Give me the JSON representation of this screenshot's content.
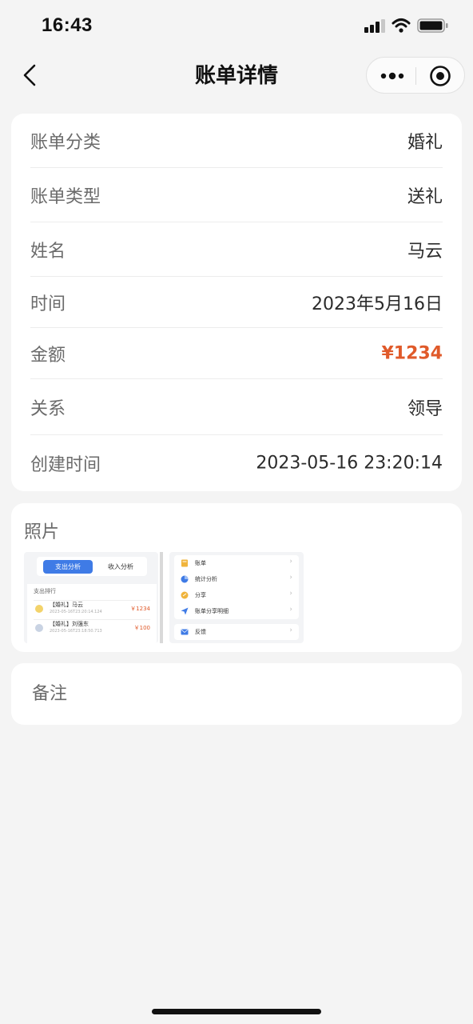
{
  "status_bar": {
    "time": "16:43",
    "icons": [
      "signal-icon",
      "wifi-icon",
      "battery-icon"
    ]
  },
  "nav": {
    "title": "账单详情",
    "back_icon": "chevron-left-icon",
    "menu_icon": "more-dots-icon",
    "close_icon": "target-circle-icon"
  },
  "details": [
    {
      "label": "账单分类",
      "value": "婚礼"
    },
    {
      "label": "账单类型",
      "value": "送礼"
    },
    {
      "label": "姓名",
      "value": "马云"
    },
    {
      "label": "时间",
      "value": "2023年5月16日"
    },
    {
      "label": "金额",
      "value": "¥1234"
    },
    {
      "label": "关系",
      "value": "领导"
    },
    {
      "label": "创建时间",
      "value": "2023-05-16 23:20:14"
    }
  ],
  "photos": {
    "title": "照片",
    "thumb1": {
      "tab_active": "支出分析",
      "tab_inactive": "收入分析",
      "section_title": "支出排行",
      "items": [
        {
          "name": "【婚礼】马云",
          "date": "2023-05-16T23:20:14.124",
          "amount": "￥1234",
          "dot_color": "#f3d36b"
        },
        {
          "name": "【婚礼】刘强东",
          "date": "2023-05-16T23:18:50.713",
          "amount": "￥100",
          "dot_color": "#c9d3e3"
        }
      ]
    },
    "thumb2": {
      "menu": [
        {
          "label": "账单",
          "icon": "book-icon",
          "color": "#f0b43c"
        },
        {
          "label": "统计分析",
          "icon": "pie-chart-icon",
          "color": "#3f7be6"
        },
        {
          "label": "分享",
          "icon": "share-icon",
          "color": "#f0b43c"
        },
        {
          "label": "账单分享明细",
          "icon": "send-icon",
          "color": "#3f7be6"
        }
      ],
      "feedback": {
        "label": "反馈",
        "icon": "mail-icon",
        "color": "#3f7be6"
      },
      "chevron": "›"
    }
  },
  "notes": {
    "title": "备注"
  },
  "colors": {
    "amount": "#e05a2a",
    "accent": "#3f7be6",
    "background": "#f4f4f4"
  }
}
